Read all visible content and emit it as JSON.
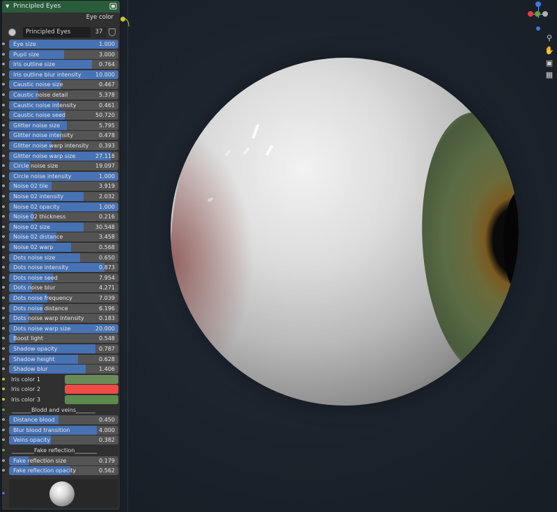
{
  "node": {
    "title": "Principled Eyes",
    "output_label": "Eye color",
    "node_group_name": "Principled Eyes",
    "node_group_users": "37"
  },
  "fields_a": [
    {
      "label": "Eye size",
      "value": "1.000",
      "fill": 1.0
    },
    {
      "label": "Pupil size",
      "value": "3.000",
      "fill": 0.5
    },
    {
      "label": "Iris outline size",
      "value": "0.764",
      "fill": 0.76
    },
    {
      "label": "Iris outline blur intensity",
      "value": "10.000",
      "fill": 1.0
    },
    {
      "label": "Caustic noise size",
      "value": "0.467",
      "fill": 0.47
    },
    {
      "label": "Caustic noise detail",
      "value": "5.378",
      "fill": 0.27
    },
    {
      "label": "Caustic noise intensity",
      "value": "0.461",
      "fill": 0.46
    },
    {
      "label": "Caustic noise seed",
      "value": "50.720",
      "fill": 0.51
    },
    {
      "label": "Glitter noise size",
      "value": "5.795",
      "fill": 0.53
    },
    {
      "label": "Glitter noise intensity",
      "value": "0.478",
      "fill": 0.48
    },
    {
      "label": "Glitter noise warp intensity",
      "value": "0.393",
      "fill": 0.39
    },
    {
      "label": "Glitter noise warp size",
      "value": "27.118",
      "fill": 0.93
    },
    {
      "label": "Circle noise size",
      "value": "19.097",
      "fill": 0.19
    },
    {
      "label": "Circle noise intensity",
      "value": "1.000",
      "fill": 1.0
    },
    {
      "label": "Noise 02 tile",
      "value": "3.919",
      "fill": 0.39
    },
    {
      "label": "Noise 02 intensity",
      "value": "2.032",
      "fill": 0.68
    },
    {
      "label": "Noise 02 opacity",
      "value": "1.000",
      "fill": 1.0
    },
    {
      "label": "Noise 02 thickness",
      "value": "0.216",
      "fill": 0.22
    },
    {
      "label": "Noise 02 size",
      "value": "30.548",
      "fill": 0.68
    },
    {
      "label": "Noise 02 distance",
      "value": "3.458",
      "fill": 0.43
    },
    {
      "label": "Noise 02 warp",
      "value": "0.568",
      "fill": 0.57
    },
    {
      "label": "Dots noise size",
      "value": "0.650",
      "fill": 0.65
    },
    {
      "label": "Dots noise intensity",
      "value": "0.873",
      "fill": 0.87
    },
    {
      "label": "Dots noise seed",
      "value": "7.954",
      "fill": 0.4
    },
    {
      "label": "Dots noise blur",
      "value": "4.271",
      "fill": 0.21
    },
    {
      "label": "Dots noise frequency",
      "value": "7.039",
      "fill": 0.35
    },
    {
      "label": "Dots noise distance",
      "value": "6.196",
      "fill": 0.31
    },
    {
      "label": "Dots noise warp intensity",
      "value": "0.183",
      "fill": 0.18
    },
    {
      "label": "Dots noise warp size",
      "value": "20.000",
      "fill": 1.0
    },
    {
      "label": "Boost light",
      "value": "0.548",
      "fill": 0.06
    },
    {
      "label": "Shadow opacity",
      "value": "0.787",
      "fill": 0.79
    },
    {
      "label": "Shadow height",
      "value": "0.628",
      "fill": 0.63
    },
    {
      "label": "Shadow blur",
      "value": "1.406",
      "fill": 0.7
    }
  ],
  "iris_colors": [
    {
      "label": "Iris color 1",
      "color": "#6b8a5a"
    },
    {
      "label": "Iris color 2",
      "color": "#f04a46"
    },
    {
      "label": "Iris color 3",
      "color": "#5d8a4e"
    }
  ],
  "separator_blood": "_______Blodd and veins_______",
  "fields_b": [
    {
      "label": "Distance blood",
      "value": "0.450",
      "fill": 0.45
    },
    {
      "label": "Blur blood transition",
      "value": "4.000",
      "fill": 0.8
    },
    {
      "label": "Veins opacity",
      "value": "0.382",
      "fill": 0.38
    }
  ],
  "separator_reflection": "________Fake reflection________",
  "fields_c": [
    {
      "label": "Fake reflection size",
      "value": "0.179",
      "fill": 0.18
    },
    {
      "label": "Fake reflection opacity",
      "value": "0.562",
      "fill": 0.56
    }
  ],
  "colors": {
    "accent": "#4772b3",
    "header": "#285c3a",
    "field_bg": "#545454"
  },
  "icons": [
    "chevron-down-icon",
    "node-options-icon",
    "material-sphere-icon",
    "fake-user-shield-icon",
    "zoom-icon",
    "hand-pan-icon",
    "camera-icon",
    "grid-icon"
  ]
}
